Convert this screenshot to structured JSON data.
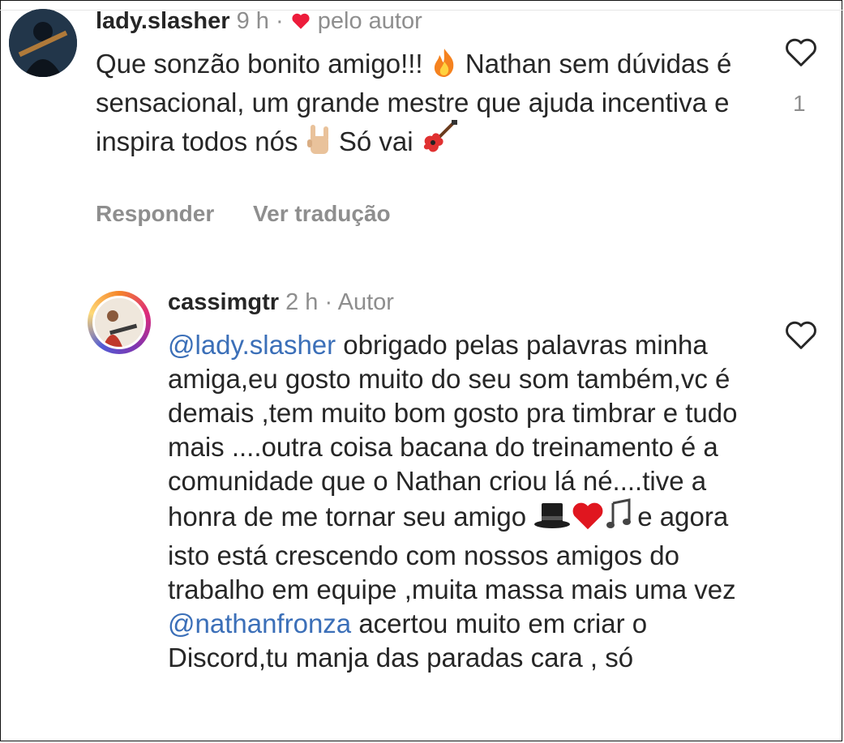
{
  "comments": [
    {
      "username": "lady.slasher",
      "time": "9 h",
      "tag": "pelo autor",
      "text_1": "Que sonzão bonito amigo!!! ",
      "text_2": " Nathan sem dúvidas é sensacional, um grande mestre que ajuda incentiva e inspira todos nós ",
      "text_3": " Só vai ",
      "like_count": "1",
      "actions": {
        "reply": "Responder",
        "translate": "Ver tradução"
      },
      "emoji": [
        "fire-icon",
        "rock-hand-icon",
        "guitar-icon"
      ]
    },
    {
      "username": "cassimgtr",
      "time": "2 h",
      "tag": "Autor",
      "mention_1": "@lady.slasher",
      "text_1": " obrigado pelas palavras minha amiga,eu gosto muito do seu som também,vc é demais ,tem muito bom gosto pra timbrar e tudo mais ....outra coisa bacana do treinamento é a comunidade que o Nathan criou lá né....tive a honra de me tornar seu amigo ",
      "text_2": "e agora isto está crescendo com nossos amigos do trabalho em equipe ,muita massa mais uma vez ",
      "mention_2": "@nathanfronza",
      "text_3": "  acertou muito em criar o Discord,tu manja das paradas cara , só",
      "emoji": [
        "top-hat-icon",
        "red-heart-icon",
        "music-notes-icon"
      ]
    }
  ],
  "colors": {
    "mention": "#3b6fb8",
    "meta": "#8e8e8e",
    "heart": "#ed1c3b"
  }
}
